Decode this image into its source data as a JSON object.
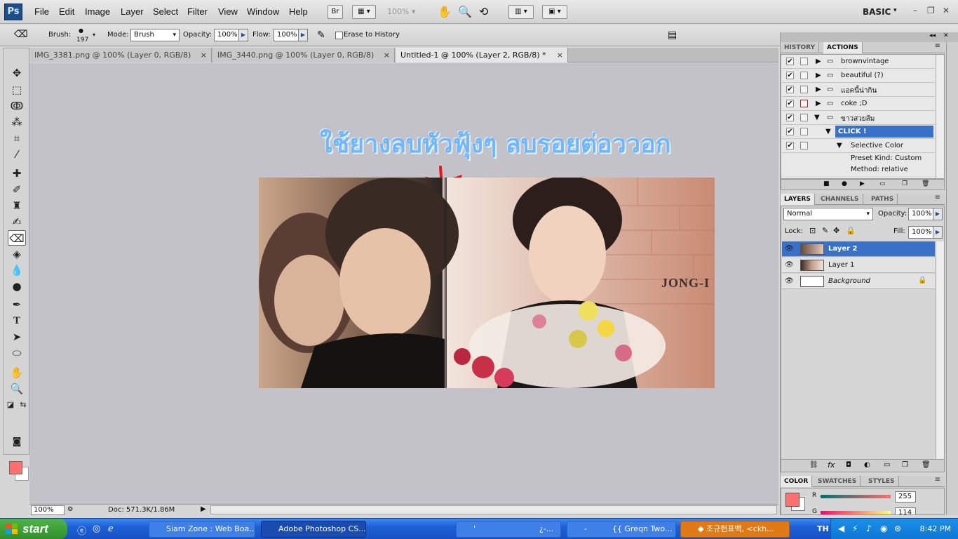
{
  "menubar": {
    "logo": "Ps",
    "items": [
      "File",
      "Edit",
      "Image",
      "Layer",
      "Select",
      "Filter",
      "View",
      "Window",
      "Help"
    ],
    "bridge_label": "Br",
    "zoom": "100%",
    "workspace": "BASIC"
  },
  "options": {
    "brush_label": "Brush:",
    "brush_size": "197",
    "mode_label": "Mode:",
    "mode_value": "Brush",
    "opacity_label": "Opacity:",
    "opacity_value": "100%",
    "flow_label": "Flow:",
    "flow_value": "100%",
    "erase_history_label": "Erase to History"
  },
  "doc_tabs": [
    {
      "label": "IMG_3381.png @ 100% (Layer 0, RGB/8)",
      "close": "×"
    },
    {
      "label": "IMG_3440.png @ 100% (Layer 0, RGB/8)",
      "close": "×"
    },
    {
      "label": "Untitled-1 @ 100% (Layer 2, RGB/8) *",
      "close": "×"
    }
  ],
  "canvas": {
    "thai_text": "ใช้ยางลบหัวฟุ้งๆ ลบรอยต่อววอก",
    "watermark": "JONG-I"
  },
  "status": {
    "zoom": "100%",
    "doc_info": "Doc: 571.3K/1.86M"
  },
  "history_panel": {
    "tabs": [
      "HISTORY",
      "ACTIONS"
    ],
    "actions": [
      {
        "label": "brownvintage"
      },
      {
        "label": "beautiful (?)"
      },
      {
        "label": "แอคนี้น่ากิน"
      },
      {
        "label": "coke ;D"
      },
      {
        "label": "ขาวสวยส้ม"
      },
      {
        "label": "CLICK !"
      },
      {
        "label": "Selective Color"
      },
      {
        "label": "Preset Kind: Custom"
      },
      {
        "label": "Method: relative"
      }
    ]
  },
  "layers_panel": {
    "tabs": [
      "LAYERS",
      "CHANNELS",
      "PATHS"
    ],
    "blend_mode": "Normal",
    "opacity_label": "Opacity:",
    "opacity_value": "100%",
    "lock_label": "Lock:",
    "fill_label": "Fill:",
    "fill_value": "100%",
    "layers": [
      {
        "name": "Layer 2"
      },
      {
        "name": "Layer 1"
      },
      {
        "name": "Background"
      }
    ]
  },
  "color_panel": {
    "tabs": [
      "COLOR",
      "SWATCHES",
      "STYLES"
    ],
    "r_label": "R",
    "r_value": "255",
    "g_label": "G",
    "g_value": "114",
    "fg_color": "#ff6f6f"
  },
  "taskbar": {
    "start_label": "start",
    "tasks": [
      {
        "label": "Siam Zone : Web Boa..."
      },
      {
        "label": "Adobe Photoshop CS..."
      },
      {
        "label": "'"
      },
      {
        "label": "¿-..."
      },
      {
        "label": "-"
      },
      {
        "label": "{{ Greqn Two..."
      },
      {
        "label": "◆ 조규현표백, <ckh..."
      }
    ],
    "language": "TH",
    "clock": "8:42 PM"
  }
}
